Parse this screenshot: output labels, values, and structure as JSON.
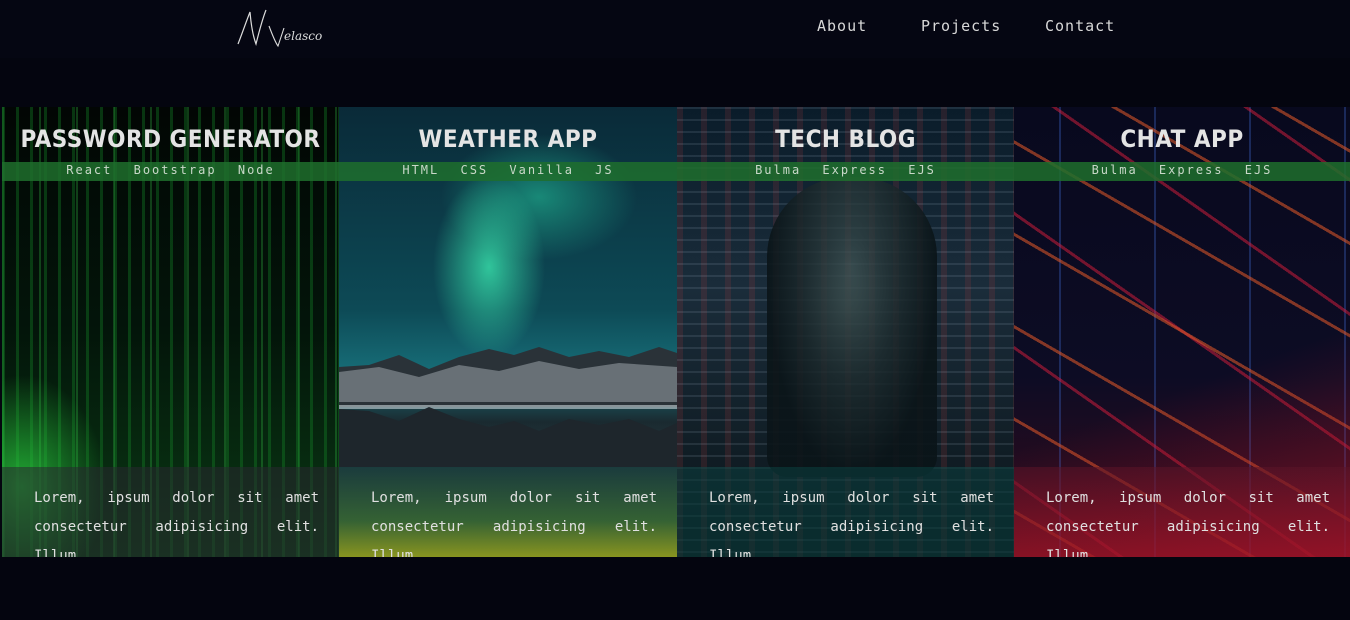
{
  "nav": {
    "logo_text": "N Velasco",
    "links": [
      "About",
      "Projects",
      "Contact"
    ]
  },
  "projects": [
    {
      "title": "PASSWORD GENERATOR",
      "tech": "React Bootstrap Node",
      "description": "Lorem, ipsum dolor sit amet consectetur adipisicing elit. Illum"
    },
    {
      "title": "WEATHER APP",
      "tech": "HTML CSS Vanilla JS",
      "description": "Lorem, ipsum dolor sit amet consectetur adipisicing elit. Illum"
    },
    {
      "title": "TECH BLOG",
      "tech": "Bulma Express EJS",
      "description": "Lorem, ipsum dolor sit amet consectetur adipisicing elit. Illum"
    },
    {
      "title": "CHAT APP",
      "tech": "Bulma Express EJS",
      "description": "Lorem, ipsum dolor sit amet consectetur adipisicing elit. Illum"
    }
  ],
  "colors": {
    "background": "#04050f",
    "tech_band": "#1e6e2d",
    "text": "#e4e4e4"
  }
}
